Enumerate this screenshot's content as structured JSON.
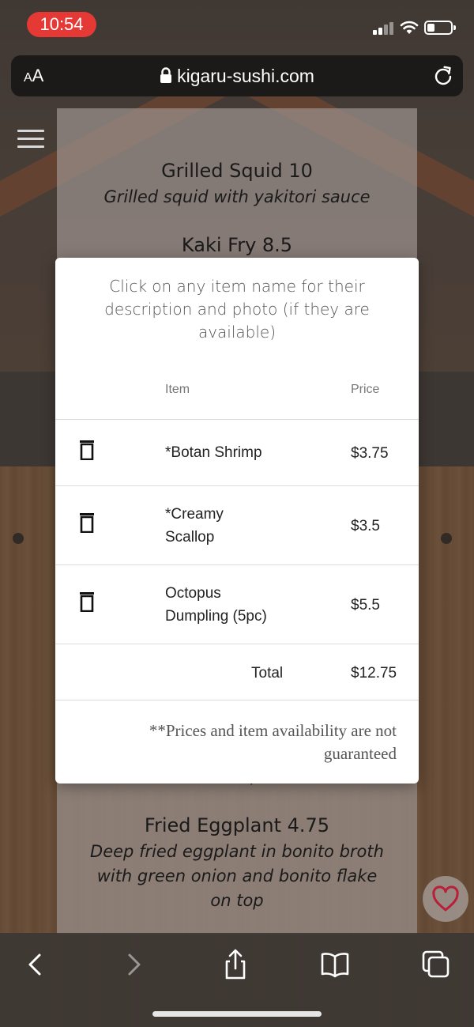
{
  "status_bar": {
    "time": "10:54"
  },
  "browser": {
    "aa_small": "A",
    "aa_large": "A",
    "url": "kigaru-sushi.com"
  },
  "page": {
    "dishes": [
      {
        "title": "Grilled Squid 10",
        "description": "Grilled squid with yakitori sauce"
      },
      {
        "title": "Kaki Fry 8.5",
        "description": ""
      },
      {
        "title": "Fried Eggplant 4.75",
        "description": "Deep fried eggplant in bonito broth with green onion and bonito flake on top"
      }
    ],
    "partial_text": "on top"
  },
  "modal": {
    "intro": "Click on any item name for their description and photo (if they are available)",
    "columns": {
      "item": "Item",
      "price": "Price"
    },
    "items": [
      {
        "name": "*Botan Shrimp",
        "price": "$3.75"
      },
      {
        "name": "*Creamy Scallop",
        "price": "$3.5"
      },
      {
        "name": "Octopus Dumpling (5pc)",
        "price": "$5.5"
      }
    ],
    "total_label": "Total",
    "total_value": "$12.75",
    "disclaimer": "**Prices and item availability are not guaranteed"
  },
  "icons": {
    "trash": "trash-icon",
    "favorite": "heart-icon",
    "back": "chevron-left-icon",
    "forward": "chevron-right-icon",
    "share": "share-icon",
    "bookmarks": "book-icon",
    "tabs": "tabs-icon"
  },
  "colors": {
    "time_pill": "#e53935",
    "heart": "#b8203a"
  },
  "battery_level": 0.25
}
